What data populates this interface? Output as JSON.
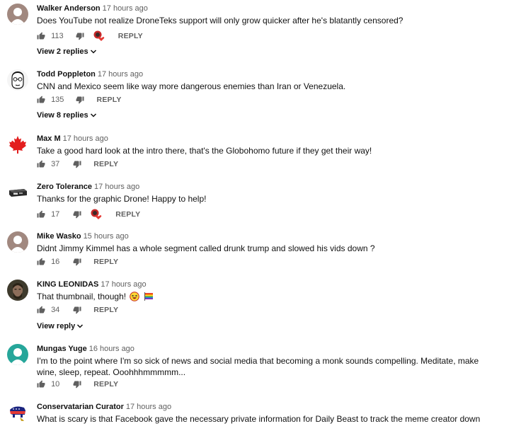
{
  "comments": [
    {
      "author": "Walker Anderson",
      "time": "17 hours ago",
      "text": "Does YouTube not realize DroneTeks support will only grow quicker after he's blatantly censored?",
      "likes": "113",
      "reply_label": "REPLY",
      "view_replies": "View 2 replies",
      "avatar": "default-avatar-brown",
      "creator_heart": true
    },
    {
      "author": "Todd Poppleton",
      "time": "17 hours ago",
      "text": "CNN and Mexico seem like way more dangerous enemies than Iran or Venezuela.",
      "likes": "135",
      "reply_label": "REPLY",
      "view_replies": "View 8 replies",
      "avatar": "sketched-face-avatar"
    },
    {
      "author": "Max M",
      "time": "17 hours ago",
      "text": "Take a good hard look at the intro there, that's the Globohomo future if they get their way!",
      "likes": "37",
      "reply_label": "REPLY",
      "avatar": "maple-leaf-avatar"
    },
    {
      "author": "Zero Tolerance",
      "time": "17 hours ago",
      "text": "Thanks for the graphic Drone!  Happy to help!",
      "likes": "17",
      "reply_label": "REPLY",
      "avatar": "device-avatar",
      "creator_heart": true
    },
    {
      "author": "Mike Wasko",
      "time": "15 hours ago",
      "text": "Didnt Jimmy Kimmel has a whole segment called drunk trump and slowed his vids down ?",
      "likes": "16",
      "reply_label": "REPLY",
      "avatar": "default-avatar-brown"
    },
    {
      "author": "KING LEONIDAS",
      "time": "17 hours ago",
      "text": "That thumbnail, though!",
      "likes": "34",
      "reply_label": "REPLY",
      "view_replies": "View reply",
      "avatar": "photo-avatar",
      "emojis": [
        "laughing-face-emoji",
        "rainbow-flag-emoji"
      ]
    },
    {
      "author": "Mungas Yuge",
      "time": "16 hours ago",
      "text": "I'm to the point where I'm so sick of news and social media that becoming a monk sounds compelling. Meditate, make wine, sleep, repeat. Ooohhhmmmmm...",
      "likes": "10",
      "reply_label": "REPLY",
      "avatar": "default-avatar-teal"
    },
    {
      "author": "Conservatarian Curator",
      "time": "17 hours ago",
      "text": "What is scary is that Facebook gave the necessary private information for Daily Beast to track the meme creator down",
      "avatar": "elephant-avatar"
    }
  ]
}
